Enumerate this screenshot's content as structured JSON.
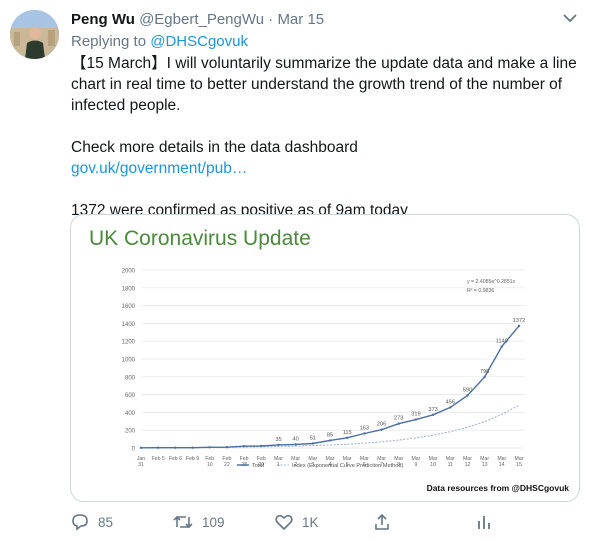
{
  "tweet": {
    "display_name": "Peng Wu",
    "handle": "@Egbert_PengWu",
    "separator": "·",
    "date": "Mar 15",
    "replying_prefix": "Replying to",
    "replying_to": "@DHSCgovuk",
    "text_line1": "【15 March】I will voluntarily summarize the update data and make a line chart in real time to better understand the growth trend of the number of infected people.",
    "text_line2": "Check more details in the data dashboard",
    "link_text": "gov.uk/government/pub…",
    "text_line3": "1372 were confirmed as positive as of 9am today"
  },
  "card": {
    "title": "UK Coronavirus Update",
    "source": "Data resources from @DHSCgovuk"
  },
  "actions": {
    "replies": "85",
    "retweets": "109",
    "likes": "1K"
  },
  "colors": {
    "link": "#1b95e0",
    "muted": "#657786",
    "title_green": "#4a8a3a",
    "series_total": "#4a6fa5",
    "series_trend": "#9fb4d8"
  },
  "chart_data": {
    "type": "line",
    "categories": [
      "Jan 31",
      "Feb 5",
      "Feb 6",
      "Feb 9",
      "Feb 10",
      "Feb 22",
      "Feb 28",
      "Feb 29",
      "Mar 1",
      "Mar 2",
      "Mar 3",
      "Mar 4",
      "Mar 5",
      "Mar 6",
      "Mar 7",
      "Mar 8",
      "Mar 9",
      "Mar 10",
      "Mar 11",
      "Mar 12",
      "Mar 13",
      "Mar 14",
      "Mar 15"
    ],
    "x_tick_labels": [
      [
        "Jan",
        "31"
      ],
      [
        "Feb 5",
        ""
      ],
      [
        "Feb 6",
        ""
      ],
      [
        "Feb 9",
        ""
      ],
      [
        "Feb",
        "10"
      ],
      [
        "Feb",
        "22"
      ],
      [
        "Feb",
        "28"
      ],
      [
        "Feb",
        "29"
      ],
      [
        "Mar",
        "1"
      ],
      [
        "Mar",
        "2"
      ],
      [
        "Mar",
        "3"
      ],
      [
        "Mar",
        "4"
      ],
      [
        "Mar",
        "5"
      ],
      [
        "Mar",
        "6"
      ],
      [
        "Mar",
        "7"
      ],
      [
        "Mar",
        "8"
      ],
      [
        "Mar",
        "9"
      ],
      [
        "Mar",
        "10"
      ],
      [
        "Mar",
        "11"
      ],
      [
        "Mar",
        "12"
      ],
      [
        "Mar",
        "13"
      ],
      [
        "Mar",
        "14"
      ],
      [
        "Mar",
        "15"
      ]
    ],
    "series": [
      {
        "name": "Total",
        "values": [
          2,
          3,
          3,
          3,
          8,
          9,
          20,
          23,
          35,
          40,
          51,
          85,
          115,
          163,
          206,
          273,
          319,
          373,
          456,
          590,
          798,
          1140,
          1372
        ]
      },
      {
        "name": "Index (Exponential Curve Prediction Method)",
        "values": [
          2.4,
          3.1,
          3.9,
          5.0,
          6.3,
          8.0,
          10.2,
          13.0,
          16.5,
          21.0,
          26.7,
          34.0,
          43.2,
          55.0,
          70.0,
          89,
          113,
          144,
          183,
          233,
          297,
          377,
          480
        ]
      }
    ],
    "data_labels": [
      "",
      "",
      "",
      "",
      "",
      "",
      "",
      "",
      "",
      "",
      "",
      "",
      "",
      "",
      "",
      "",
      "",
      "",
      "",
      "",
      "",
      "1140",
      "1372"
    ],
    "point_labels": [
      "",
      "",
      "",
      "",
      "",
      "",
      "",
      "",
      "35",
      "40",
      "51",
      "85",
      "115",
      "163",
      "206",
      "273",
      "319",
      "373",
      "456",
      "590",
      "798",
      "1140",
      "1372"
    ],
    "ylim": [
      0,
      2000
    ],
    "yticks": [
      0,
      200,
      400,
      600,
      800,
      1000,
      1200,
      1400,
      1600,
      1800,
      2000
    ],
    "legend_position": "bottom",
    "annotation": [
      "y = 2.4085e^0.2851x",
      "R² = 0.9836"
    ]
  }
}
